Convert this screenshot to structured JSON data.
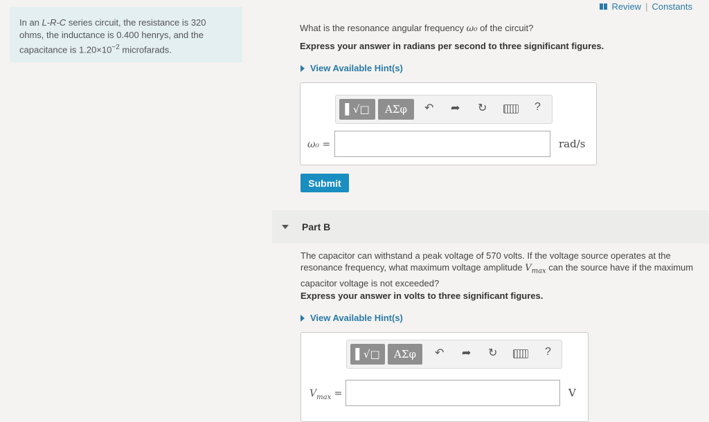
{
  "header": {
    "review_label": "Review",
    "separator": "|",
    "constants_label": "Constants"
  },
  "problem": {
    "text_before": "In an ",
    "lrc": "L-R-C",
    "text_mid": " series circuit, the resistance is 320 ohms, the inductance is 0.400 henrys, and the capacitance is 1.20×10",
    "exponent": "−2",
    "text_after": " microfarads."
  },
  "part_a": {
    "question_before": "What is the resonance angular frequency ",
    "question_var": "ω₀",
    "question_after": " of the circuit?",
    "instruction": "Express your answer in radians per second to three significant figures.",
    "hint_label": "View Available Hint(s)",
    "toolbar": {
      "templates_label": "▌√□",
      "symbols_label": "ΑΣφ",
      "undo_icon": "↶",
      "redo_icon": "➦",
      "reset_icon": "↻",
      "help_label": "?"
    },
    "var_label": "ω₀ =",
    "input_value": "",
    "unit": "rad/s",
    "submit_label": "Submit"
  },
  "part_b": {
    "title": "Part B",
    "text_1": "The capacitor can withstand a peak voltage of 570 volts. If the voltage source operates at the resonance frequency, what maximum voltage amplitude ",
    "text_var": "V",
    "text_var_sub": "max",
    "text_2": " can the source have if the maximum capacitor voltage is not exceeded?",
    "instruction": "Express your answer in volts to three significant figures.",
    "hint_label": "View Available Hint(s)",
    "toolbar": {
      "templates_label": "▌√□",
      "symbols_label": "ΑΣφ",
      "undo_icon": "↶",
      "redo_icon": "➦",
      "reset_icon": "↻",
      "help_label": "?"
    },
    "var_label": "V",
    "var_sub": "max",
    "var_eq": " =",
    "input_value": "",
    "unit": "V"
  }
}
